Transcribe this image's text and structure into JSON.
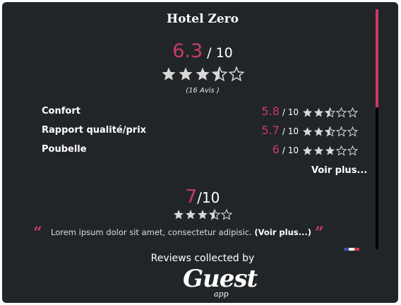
{
  "hotel": {
    "name": "Hotel Zero"
  },
  "overall": {
    "score": "6.3",
    "out_of": "/ 10",
    "rating": 3.5,
    "max": 5,
    "reviews_count": "(16 Avis )"
  },
  "criteria": [
    {
      "label": "Confort",
      "score": "5.8",
      "out_of": "/ 10",
      "rating": 2.5
    },
    {
      "label": "Rapport qualité/prix",
      "score": "5.7",
      "out_of": "/ 10",
      "rating": 2.5
    },
    {
      "label": "Poubelle",
      "score": "6",
      "out_of": "/ 10",
      "rating": 3
    }
  ],
  "see_more": "Voir plus...",
  "review": {
    "score": "7",
    "out_of": "/10",
    "rating": 3.5,
    "text": "Lorem ipsum dolor sit amet, consectetur adipisic.",
    "more": "(Voir plus...)",
    "open_quote": "“",
    "close_quote": "”"
  },
  "footer": {
    "collected_by": "Reviews collected by",
    "brand": "Guest",
    "brand_sub": "app"
  },
  "colors": {
    "accent": "#c83c63",
    "background": "#222528",
    "star": "#d9d9d9"
  },
  "scroll": {
    "position": 0,
    "visible_fraction": 0.41
  }
}
